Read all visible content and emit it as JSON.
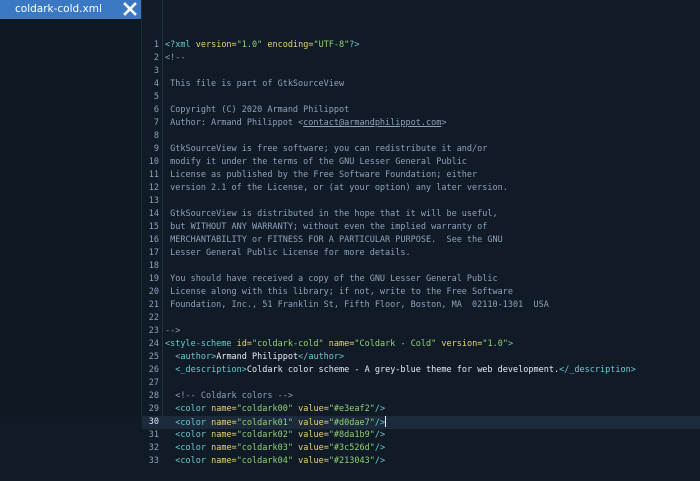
{
  "tab": {
    "filename": "coldark-cold.xml",
    "close_icon": "close-icon"
  },
  "editor": {
    "current_line": 30,
    "lines": [
      {
        "n": "1",
        "t": [
          [
            "<?",
            "tag"
          ],
          [
            "xml",
            "tag"
          ],
          [
            " version=",
            "attr"
          ],
          [
            "\"1.0\"",
            "val"
          ],
          [
            " encoding=",
            "attr"
          ],
          [
            "\"UTF-8\"",
            "val"
          ],
          [
            "?>",
            "tag"
          ]
        ]
      },
      {
        "n": "2",
        "t": [
          [
            "<!--",
            "com"
          ]
        ]
      },
      {
        "n": "3",
        "t": []
      },
      {
        "n": "4",
        "t": [
          [
            " This file is part of GtkSourceView",
            "com"
          ]
        ]
      },
      {
        "n": "5",
        "t": []
      },
      {
        "n": "6",
        "t": [
          [
            " Copyright (C) 2020 Armand Philippot",
            "com"
          ]
        ]
      },
      {
        "n": "7",
        "t": [
          [
            " Author: Armand Philippot <",
            "com"
          ],
          [
            "contact@armandphilippot.com",
            "link"
          ],
          [
            ">",
            "com"
          ]
        ]
      },
      {
        "n": "8",
        "t": []
      },
      {
        "n": "9",
        "t": [
          [
            " GtkSourceView is free software; you can redistribute it and/or",
            "com"
          ]
        ]
      },
      {
        "n": "10",
        "t": [
          [
            " modify it under the terms of the GNU Lesser General Public",
            "com"
          ]
        ]
      },
      {
        "n": "11",
        "t": [
          [
            " License as published by the Free Software Foundation; either",
            "com"
          ]
        ]
      },
      {
        "n": "12",
        "t": [
          [
            " version 2.1 of the License, or (at your option) any later version.",
            "com"
          ]
        ]
      },
      {
        "n": "13",
        "t": []
      },
      {
        "n": "14",
        "t": [
          [
            " GtkSourceView is distributed in the hope that it will be useful,",
            "com"
          ]
        ]
      },
      {
        "n": "15",
        "t": [
          [
            " but WITHOUT ANY WARRANTY; without even the implied warranty of",
            "com"
          ]
        ]
      },
      {
        "n": "16",
        "t": [
          [
            " MERCHANTABILITY or FITNESS FOR A PARTICULAR PURPOSE.  See the GNU",
            "com"
          ]
        ]
      },
      {
        "n": "17",
        "t": [
          [
            " Lesser General Public License for more details.",
            "com"
          ]
        ]
      },
      {
        "n": "18",
        "t": []
      },
      {
        "n": "19",
        "t": [
          [
            " You should have received a copy of the GNU Lesser General Public",
            "com"
          ]
        ]
      },
      {
        "n": "20",
        "t": [
          [
            " License along with this library; if not, write to the Free Software",
            "com"
          ]
        ]
      },
      {
        "n": "21",
        "t": [
          [
            " Foundation, Inc., 51 Franklin St, Fifth Floor, Boston, MA  02110-1301  USA",
            "com"
          ]
        ]
      },
      {
        "n": "22",
        "t": []
      },
      {
        "n": "23",
        "t": [
          [
            "-->",
            "com"
          ]
        ]
      },
      {
        "n": "24",
        "t": [
          [
            "<style-scheme",
            "tag"
          ],
          [
            " id=",
            "attr"
          ],
          [
            "\"coldark-cold\"",
            "val"
          ],
          [
            " name=",
            "attr"
          ],
          [
            "\"Coldark - Cold\"",
            "val"
          ],
          [
            " version=",
            "attr"
          ],
          [
            "\"1.0\"",
            "val"
          ],
          [
            ">",
            "tag"
          ]
        ]
      },
      {
        "n": "25",
        "t": [
          [
            "  ",
            "ws"
          ],
          [
            "<author>",
            "tag"
          ],
          [
            "Armand Philippot",
            "txt"
          ],
          [
            "</author>",
            "tag"
          ]
        ]
      },
      {
        "n": "26",
        "t": [
          [
            "  ",
            "ws"
          ],
          [
            "<_description>",
            "tag"
          ],
          [
            "Coldark color scheme - A grey-blue theme for web development.",
            "txt"
          ],
          [
            "</_description>",
            "tag"
          ]
        ]
      },
      {
        "n": "27",
        "t": []
      },
      {
        "n": "28",
        "t": [
          [
            "  ",
            "ws"
          ],
          [
            "<!-- Coldark colors -->",
            "com"
          ]
        ]
      },
      {
        "n": "29",
        "t": [
          [
            "  ",
            "ws"
          ],
          [
            "<color",
            "tag"
          ],
          [
            " name=",
            "attr"
          ],
          [
            "\"coldark00\"",
            "val"
          ],
          [
            " value=",
            "attr"
          ],
          [
            "\"#e3eaf2\"",
            "val"
          ],
          [
            "/>",
            "tag"
          ]
        ]
      },
      {
        "n": "30",
        "t": [
          [
            "  ",
            "ws"
          ],
          [
            "<color",
            "tag"
          ],
          [
            " name=",
            "attr"
          ],
          [
            "\"coldark01\"",
            "val"
          ],
          [
            " value=",
            "attr"
          ],
          [
            "\"#d0dae7\"",
            "val"
          ],
          [
            "/>",
            "tag"
          ]
        ]
      },
      {
        "n": "31",
        "t": [
          [
            "  ",
            "ws"
          ],
          [
            "<color",
            "tag"
          ],
          [
            " name=",
            "attr"
          ],
          [
            "\"coldark02\"",
            "val"
          ],
          [
            " value=",
            "attr"
          ],
          [
            "\"#8da1b9\"",
            "val"
          ],
          [
            "/>",
            "tag"
          ]
        ]
      },
      {
        "n": "32",
        "t": [
          [
            "  ",
            "ws"
          ],
          [
            "<color",
            "tag"
          ],
          [
            " name=",
            "attr"
          ],
          [
            "\"coldark03\"",
            "val"
          ],
          [
            " value=",
            "attr"
          ],
          [
            "\"#3c526d\"",
            "val"
          ],
          [
            "/>",
            "tag"
          ]
        ]
      },
      {
        "n": "33",
        "t": [
          [
            "  ",
            "ws"
          ],
          [
            "<color",
            "tag"
          ],
          [
            " name=",
            "attr"
          ],
          [
            "\"coldark04\"",
            "val"
          ],
          [
            " value=",
            "attr"
          ],
          [
            "\"#213043\"",
            "val"
          ],
          [
            "/>",
            "tag"
          ]
        ]
      }
    ]
  }
}
